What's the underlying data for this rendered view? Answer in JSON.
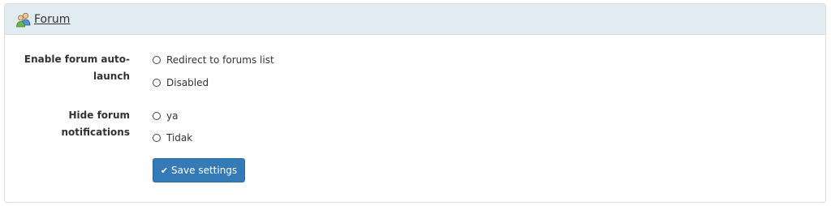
{
  "panel": {
    "title": "Forum",
    "icon": "forum-users-icon"
  },
  "fields": [
    {
      "label_line1": "Enable forum auto-",
      "label_line2": "launch",
      "options": [
        "Redirect to forums list",
        "Disabled"
      ]
    },
    {
      "label_line1": "Hide forum",
      "label_line2": "notifications",
      "options": [
        "ya",
        "Tidak"
      ]
    }
  ],
  "save_button": {
    "label": "Save settings",
    "icon": "check-icon",
    "color": "#337ab7"
  },
  "colors": {
    "heading_bg": "#e1ecf1",
    "border": "#d6dde3"
  }
}
